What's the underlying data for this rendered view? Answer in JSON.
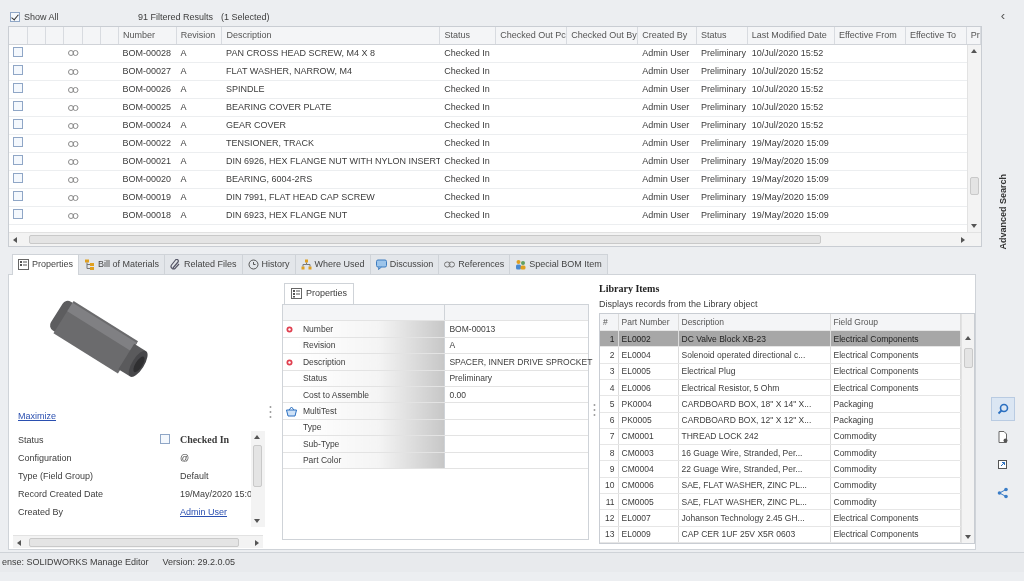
{
  "top_bar": {
    "show_all": {
      "label": "Show All",
      "checked": true
    },
    "results": "91 Filtered Results",
    "selection": "(1 Selected)"
  },
  "results_table": {
    "columns": [
      "Number",
      "Revision",
      "Description",
      "Status",
      "Checked Out Pc",
      "Checked Out By",
      "Created By",
      "Status",
      "Last Modified Date",
      "Effective From",
      "Effective To",
      "Pr"
    ],
    "rows": [
      {
        "checked": false,
        "number": "BOM-00028",
        "revision": "A",
        "description": "PAN CROSS HEAD SCREW, M4 X 8",
        "status": "Checked In",
        "created_by": "Admin User",
        "state": "Preliminary",
        "last_modified": "10/Jul/2020 15:52"
      },
      {
        "checked": false,
        "number": "BOM-00027",
        "revision": "A",
        "description": "FLAT WASHER, NARROW, M4",
        "status": "Checked In",
        "created_by": "Admin User",
        "state": "Preliminary",
        "last_modified": "10/Jul/2020 15:52"
      },
      {
        "checked": false,
        "number": "BOM-00026",
        "revision": "A",
        "description": "SPINDLE",
        "status": "Checked In",
        "created_by": "Admin User",
        "state": "Preliminary",
        "last_modified": "10/Jul/2020 15:52"
      },
      {
        "checked": false,
        "number": "BOM-00025",
        "revision": "A",
        "description": "BEARING COVER PLATE",
        "status": "Checked In",
        "created_by": "Admin User",
        "state": "Preliminary",
        "last_modified": "10/Jul/2020 15:52"
      },
      {
        "checked": false,
        "number": "BOM-00024",
        "revision": "A",
        "description": "GEAR COVER",
        "status": "Checked In",
        "created_by": "Admin User",
        "state": "Preliminary",
        "last_modified": "10/Jul/2020 15:52"
      },
      {
        "checked": false,
        "number": "BOM-00022",
        "revision": "A",
        "description": "TENSIONER, TRACK",
        "status": "Checked In",
        "created_by": "Admin User",
        "state": "Preliminary",
        "last_modified": "19/May/2020 15:09"
      },
      {
        "checked": false,
        "number": "BOM-00021",
        "revision": "A",
        "description": "DIN 6926, HEX FLANGE NUT WITH NYLON INSERT",
        "status": "Checked In",
        "created_by": "Admin User",
        "state": "Preliminary",
        "last_modified": "19/May/2020 15:09"
      },
      {
        "checked": false,
        "number": "BOM-00020",
        "revision": "A",
        "description": "BEARING, 6004-2RS",
        "status": "Checked In",
        "created_by": "Admin User",
        "state": "Preliminary",
        "last_modified": "19/May/2020 15:09"
      },
      {
        "checked": false,
        "number": "BOM-00019",
        "revision": "A",
        "description": "DIN 7991, FLAT HEAD CAP SCREW",
        "status": "Checked In",
        "created_by": "Admin User",
        "state": "Preliminary",
        "last_modified": "19/May/2020 15:09"
      },
      {
        "checked": false,
        "number": "BOM-00018",
        "revision": "A",
        "description": "DIN 6923, HEX FLANGE NUT",
        "status": "Checked In",
        "created_by": "Admin User",
        "state": "Preliminary",
        "last_modified": "19/May/2020 15:09"
      }
    ]
  },
  "tabs": [
    {
      "label": "Properties",
      "selected": true
    },
    {
      "label": "Bill of Materials",
      "selected": false
    },
    {
      "label": "Related Files",
      "selected": false
    },
    {
      "label": "History",
      "selected": false
    },
    {
      "label": "Where Used",
      "selected": false
    },
    {
      "label": "Discussion",
      "selected": false
    },
    {
      "label": "References",
      "selected": false
    },
    {
      "label": "Special BOM Item",
      "selected": false
    }
  ],
  "summary_panel": {
    "maximize_link": "Maximize",
    "fields": [
      {
        "kind": "status",
        "label": "Status",
        "value": "Checked In",
        "checked": false
      },
      {
        "kind": "text",
        "label": "Configuration",
        "value": "@"
      },
      {
        "kind": "text",
        "label": "Type (Field Group)",
        "value": "Default"
      },
      {
        "kind": "text",
        "label": "Record Created Date",
        "value": "19/May/2020 15:0"
      },
      {
        "kind": "link",
        "label": "Created By",
        "value": "Admin User"
      }
    ]
  },
  "properties_panel": {
    "tab": "Properties",
    "fields": [
      {
        "kind": "field",
        "label": "Number",
        "value": "BOM-00013",
        "required": true
      },
      {
        "kind": "field",
        "label": "Revision",
        "value": "A",
        "required": false
      },
      {
        "kind": "field",
        "label": "Description",
        "value": "SPACER, INNER DRIVE SPROCKET",
        "required": true
      },
      {
        "kind": "field",
        "label": "Status",
        "value": "Preliminary",
        "required": false
      },
      {
        "kind": "field",
        "label": "Cost to Assemble",
        "value": "0.00",
        "required": false
      },
      {
        "kind": "multi",
        "label": "MultiTest",
        "required": false
      },
      {
        "kind": "field",
        "label": "Type",
        "required": false
      },
      {
        "kind": "field",
        "label": "Sub-Type",
        "required": false
      },
      {
        "kind": "field",
        "label": "Part Color",
        "required": false
      }
    ]
  },
  "library": {
    "title": "Library Items",
    "subtitle": "Displays records from the Library object",
    "columns": [
      "#",
      "Part Number",
      "Description",
      "Field Group"
    ],
    "rows": [
      {
        "selected": true,
        "index": "1",
        "part_number": "EL0002",
        "description": "DC Valve Block XB-23",
        "field_group": "Electrical Components"
      },
      {
        "selected": false,
        "index": "2",
        "part_number": "EL0004",
        "description": "Solenoid operated directional c...",
        "field_group": "Electrical Components"
      },
      {
        "selected": false,
        "index": "3",
        "part_number": "EL0005",
        "description": "Electrical Plug",
        "field_group": "Electrical Components"
      },
      {
        "selected": false,
        "index": "4",
        "part_number": "EL0006",
        "description": "Electrical Resistor, 5 Ohm",
        "field_group": "Electrical Components"
      },
      {
        "selected": false,
        "index": "5",
        "part_number": "PK0004",
        "description": "CARDBOARD BOX, 18\" X 14\" X...",
        "field_group": "Packaging"
      },
      {
        "selected": false,
        "index": "6",
        "part_number": "PK0005",
        "description": "CARDBOARD BOX, 12\" X 12\" X...",
        "field_group": "Packaging"
      },
      {
        "selected": false,
        "index": "7",
        "part_number": "CM0001",
        "description": "THREAD LOCK 242",
        "field_group": "Commodity"
      },
      {
        "selected": false,
        "index": "8",
        "part_number": "CM0003",
        "description": "16 Guage Wire, Stranded, Per...",
        "field_group": "Commodity"
      },
      {
        "selected": false,
        "index": "9",
        "part_number": "CM0004",
        "description": "22 Guage Wire, Stranded, Per...",
        "field_group": "Commodity"
      },
      {
        "selected": false,
        "index": "10",
        "part_number": "CM0006",
        "description": "SAE, FLAT WASHER, ZINC PL...",
        "field_group": "Commodity"
      },
      {
        "selected": false,
        "index": "11",
        "part_number": "CM0005",
        "description": "SAE, FLAT WASHER, ZINC PL...",
        "field_group": "Commodity"
      },
      {
        "selected": false,
        "index": "12",
        "part_number": "EL0007",
        "description": "Johanson Technology 2.45 GH...",
        "field_group": "Electrical Components"
      },
      {
        "selected": false,
        "index": "13",
        "part_number": "EL0009",
        "description": "CAP CER 1UF 25V X5R 0603",
        "field_group": "Electrical Components"
      }
    ]
  },
  "side_panel": {
    "collapse": "‹",
    "title": "Advanced Search"
  },
  "side_tools": [
    {
      "selected": true
    },
    {
      "selected": false
    },
    {
      "selected": false
    },
    {
      "selected": false
    }
  ],
  "status_bar": {
    "license": "ense: SOLIDWORKS Manage Editor",
    "version": "Version: 29.2.0.05"
  }
}
